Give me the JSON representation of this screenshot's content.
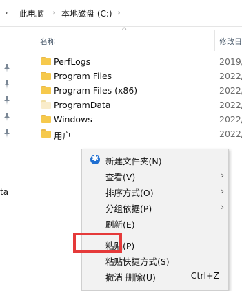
{
  "breadcrumb": {
    "sep": "›",
    "items": [
      "此电脑",
      "本地磁盘 (C:)"
    ],
    "expand": "›"
  },
  "left_nav": {
    "fragment": "ta"
  },
  "columns": {
    "name": "名称",
    "date": "修改日",
    "sort_indicator": "^"
  },
  "files": [
    {
      "name": "PerfLogs",
      "date": "2019/",
      "icon": "folder-icon",
      "hidden": false
    },
    {
      "name": "Program Files",
      "date": "2022/",
      "icon": "folder-icon",
      "hidden": false
    },
    {
      "name": "Program Files (x86)",
      "date": "2022/",
      "icon": "folder-icon",
      "hidden": false
    },
    {
      "name": "ProgramData",
      "date": "2022/",
      "icon": "folder-icon",
      "hidden": true
    },
    {
      "name": "Windows",
      "date": "2022/",
      "icon": "folder-icon",
      "hidden": false
    },
    {
      "name": "用户",
      "date": "2022/",
      "icon": "folder-icon",
      "hidden": false
    }
  ],
  "context_menu": {
    "items": [
      {
        "label": "新建文件夹(N)",
        "icon": "new-folder-icon"
      },
      {
        "label": "查看(V)",
        "submenu": true
      },
      {
        "label": "排序方式(O)",
        "submenu": true
      },
      {
        "label": "分组依据(P)",
        "submenu": true
      },
      {
        "label": "刷新(E)"
      },
      {
        "label": "粘贴(P)",
        "highlighted": true
      },
      {
        "label": "粘贴快捷方式(S)"
      },
      {
        "label": "撤消 删除(U)",
        "shortcut": "Ctrl+Z"
      }
    ],
    "arrow": "›",
    "highlight_color": "#e53a3a"
  }
}
